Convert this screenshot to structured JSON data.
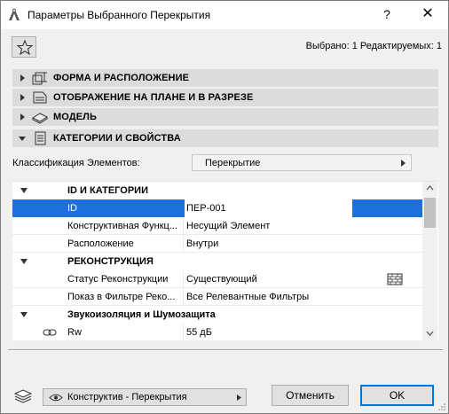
{
  "window": {
    "title": "Параметры Выбранного Перекрытия",
    "help_label": "?",
    "close_label": "✕"
  },
  "header": {
    "selected_info": "Выбрано: 1 Редактируемых: 1"
  },
  "sections": [
    {
      "label": "ФОРМА И РАСПОЛОЖЕНИЕ",
      "expanded": false
    },
    {
      "label": "ОТОБРАЖЕНИЕ НА ПЛАНЕ И В РАЗРЕЗЕ",
      "expanded": false
    },
    {
      "label": "МОДЕЛЬ",
      "expanded": false
    },
    {
      "label": "КАТЕГОРИИ И СВОЙСТВА",
      "expanded": true
    }
  ],
  "classification": {
    "label": "Классификация Элементов:",
    "value": "Перекрытие"
  },
  "properties": {
    "groups": [
      {
        "title": "ID И КАТЕГОРИИ",
        "rows": [
          {
            "name": "ID",
            "value": "ПЕР-001",
            "selected": true
          },
          {
            "name": "Конструктивная Функц...",
            "value": "Несущий Элемент"
          },
          {
            "name": "Расположение",
            "value": "Внутри"
          }
        ]
      },
      {
        "title": "РЕКОНСТРУКЦИЯ",
        "rows": [
          {
            "name": "Статус Реконструкции",
            "value": "Существующий"
          },
          {
            "name": "Показ в Фильтре Реко...",
            "value": "Все Релевантные Фильтры"
          }
        ]
      },
      {
        "title": "Звукоизоляция и Шумозащита",
        "rows": [
          {
            "name": "Rw",
            "value": "55 дБ"
          }
        ]
      }
    ]
  },
  "footer": {
    "view_value": "Конструктив - Перекрытия",
    "cancel_label": "Отменить",
    "ok_label": "OK"
  },
  "colors": {
    "selection": "#1e6fd9",
    "section_bg": "#dcdcdc",
    "dialog_bg": "#f0f0f0",
    "ok_border": "#0078d7"
  },
  "icons": {
    "app": "archicad-icon",
    "favorites": "star-icon",
    "section_1": "geometry-icon",
    "section_2": "floor-plan-icon",
    "section_3": "model-icon",
    "section_4": "document-list-icon",
    "renovation_status": "brick-wall-icon",
    "rw": "link-icon",
    "layer": "layers-icon",
    "view": "eye-icon"
  }
}
